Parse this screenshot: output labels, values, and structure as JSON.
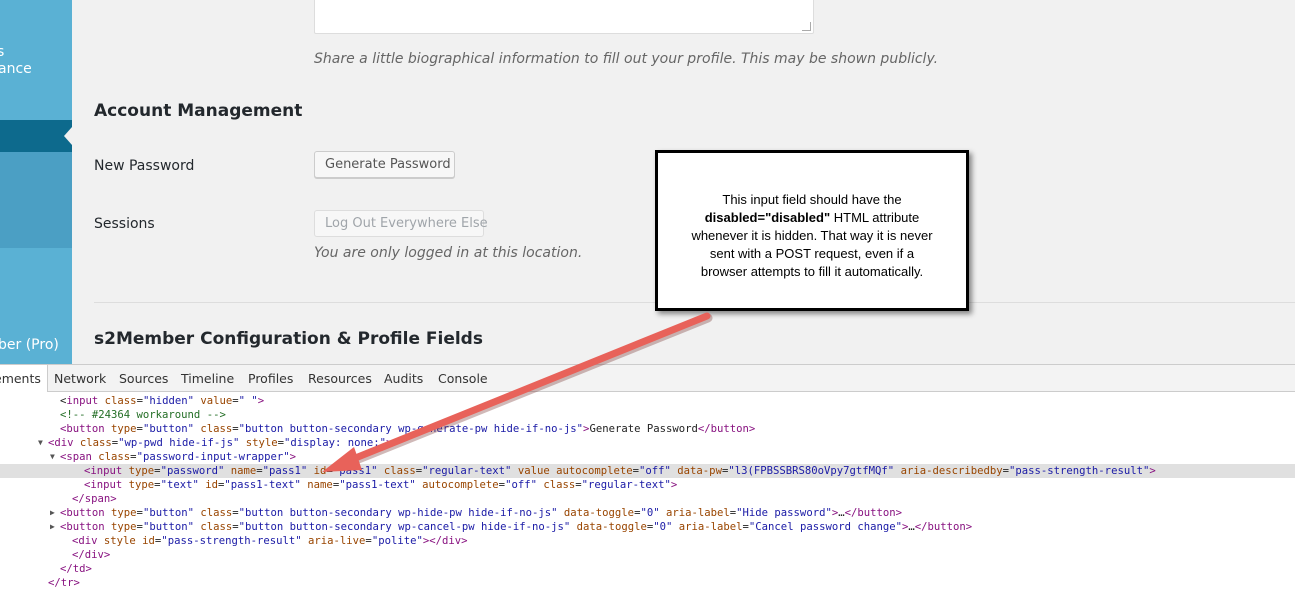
{
  "sidebar": {
    "items": [
      {
        "label": "s"
      },
      {
        "label": "ance"
      },
      {
        "label": "ber (Pro)"
      }
    ]
  },
  "profile": {
    "bio_description": "Share a little biographical information to fill out your profile. This may be shown publicly.",
    "account_heading": "Account Management",
    "new_password_label": "New Password",
    "generate_password_button": "Generate Password",
    "sessions_label": "Sessions",
    "logout_everywhere_button": "Log Out Everywhere Else",
    "sessions_description": "You are only logged in at this location.",
    "s2member_heading": "s2Member Configuration & Profile Fields"
  },
  "callout": {
    "line1": "This input field should have the",
    "bold": "disabled=\"disabled\"",
    "line2_rest": " HTML attribute",
    "line3": "whenever it is hidden. That way it is never",
    "line4": "sent with a POST request, even if a",
    "line5": "browser attempts to fill it automatically."
  },
  "devtools": {
    "tabs": [
      "ements",
      "Network",
      "Sources",
      "Timeline",
      "Profiles",
      "Resources",
      "Audits",
      "Console"
    ],
    "active_tab": "ements",
    "lines": [
      {
        "indent": 5,
        "tri": "",
        "sel": false,
        "parts": [
          [
            "tx",
            "<"
          ],
          [
            "tag",
            "input "
          ],
          [
            "an",
            "class"
          ],
          [
            "tx",
            "="
          ],
          [
            "av",
            "\"hidden\" "
          ],
          [
            "an",
            "value"
          ],
          [
            "tx",
            "="
          ],
          [
            "av",
            "\" \""
          ],
          [
            "tag",
            ">"
          ]
        ]
      },
      {
        "indent": 5,
        "tri": "",
        "sel": false,
        "parts": [
          [
            "cm",
            "<!-- #24364 workaround -->"
          ]
        ]
      },
      {
        "indent": 5,
        "tri": "",
        "sel": false,
        "parts": [
          [
            "tag",
            "<button "
          ],
          [
            "an",
            "type"
          ],
          [
            "tx",
            "="
          ],
          [
            "av",
            "\"button\" "
          ],
          [
            "an",
            "class"
          ],
          [
            "tx",
            "="
          ],
          [
            "av",
            "\"button button-secondary wp-generate-pw hide-if-no-js\""
          ],
          [
            "tag",
            ">"
          ],
          [
            "tx",
            "Generate Password"
          ],
          [
            "tag",
            "</button>"
          ]
        ]
      },
      {
        "indent": 4,
        "tri": "▼",
        "sel": false,
        "parts": [
          [
            "tag",
            "<div "
          ],
          [
            "an",
            "class"
          ],
          [
            "tx",
            "="
          ],
          [
            "av",
            "\"wp-pwd hide-if-js\" "
          ],
          [
            "an",
            "style"
          ],
          [
            "tx",
            "="
          ],
          [
            "av",
            "\"display: none;\""
          ],
          [
            "tag",
            ">"
          ]
        ]
      },
      {
        "indent": 5,
        "tri": "▼",
        "sel": false,
        "parts": [
          [
            "tag",
            "<span "
          ],
          [
            "an",
            "class"
          ],
          [
            "tx",
            "="
          ],
          [
            "av",
            "\"password-input-wrapper\""
          ],
          [
            "tag",
            ">"
          ]
        ]
      },
      {
        "indent": 7,
        "tri": "",
        "sel": true,
        "parts": [
          [
            "tag",
            "<input "
          ],
          [
            "an",
            "type"
          ],
          [
            "tx",
            "="
          ],
          [
            "av",
            "\"password\" "
          ],
          [
            "an",
            "name"
          ],
          [
            "tx",
            "="
          ],
          [
            "av",
            "\"pass1\" "
          ],
          [
            "an",
            "id"
          ],
          [
            "tx",
            "="
          ],
          [
            "av",
            "\"pass1\" "
          ],
          [
            "an",
            "class"
          ],
          [
            "tx",
            "="
          ],
          [
            "av",
            "\"regular-text\" "
          ],
          [
            "an",
            "value autocomplete"
          ],
          [
            "tx",
            "="
          ],
          [
            "av",
            "\"off\" "
          ],
          [
            "an",
            "data-pw"
          ],
          [
            "tx",
            "="
          ],
          [
            "av",
            "\"l3(FPBSSBRS80oVpy7gtfMQf\" "
          ],
          [
            "an",
            "aria-describedby"
          ],
          [
            "tx",
            "="
          ],
          [
            "av",
            "\"pass-strength-result\""
          ],
          [
            "tag",
            ">"
          ]
        ]
      },
      {
        "indent": 7,
        "tri": "",
        "sel": false,
        "parts": [
          [
            "tag",
            "<input "
          ],
          [
            "an",
            "type"
          ],
          [
            "tx",
            "="
          ],
          [
            "av",
            "\"text\" "
          ],
          [
            "an",
            "id"
          ],
          [
            "tx",
            "="
          ],
          [
            "av",
            "\"pass1-text\" "
          ],
          [
            "an",
            "name"
          ],
          [
            "tx",
            "="
          ],
          [
            "av",
            "\"pass1-text\" "
          ],
          [
            "an",
            "autocomplete"
          ],
          [
            "tx",
            "="
          ],
          [
            "av",
            "\"off\" "
          ],
          [
            "an",
            "class"
          ],
          [
            "tx",
            "="
          ],
          [
            "av",
            "\"regular-text\""
          ],
          [
            "tag",
            ">"
          ]
        ]
      },
      {
        "indent": 6,
        "tri": "",
        "sel": false,
        "parts": [
          [
            "tag",
            "</span>"
          ]
        ]
      },
      {
        "indent": 5,
        "tri": "▶",
        "sel": false,
        "parts": [
          [
            "tag",
            "<button "
          ],
          [
            "an",
            "type"
          ],
          [
            "tx",
            "="
          ],
          [
            "av",
            "\"button\" "
          ],
          [
            "an",
            "class"
          ],
          [
            "tx",
            "="
          ],
          [
            "av",
            "\"button button-secondary wp-hide-pw hide-if-no-js\" "
          ],
          [
            "an",
            "data-toggle"
          ],
          [
            "tx",
            "="
          ],
          [
            "av",
            "\"0\" "
          ],
          [
            "an",
            "aria-label"
          ],
          [
            "tx",
            "="
          ],
          [
            "av",
            "\"Hide password\""
          ],
          [
            "tag",
            ">"
          ],
          [
            "tx",
            "…"
          ],
          [
            "tag",
            "</button>"
          ]
        ]
      },
      {
        "indent": 5,
        "tri": "▶",
        "sel": false,
        "parts": [
          [
            "tag",
            "<button "
          ],
          [
            "an",
            "type"
          ],
          [
            "tx",
            "="
          ],
          [
            "av",
            "\"button\" "
          ],
          [
            "an",
            "class"
          ],
          [
            "tx",
            "="
          ],
          [
            "av",
            "\"button button-secondary wp-cancel-pw hide-if-no-js\" "
          ],
          [
            "an",
            "data-toggle"
          ],
          [
            "tx",
            "="
          ],
          [
            "av",
            "\"0\" "
          ],
          [
            "an",
            "aria-label"
          ],
          [
            "tx",
            "="
          ],
          [
            "av",
            "\"Cancel password change\""
          ],
          [
            "tag",
            ">"
          ],
          [
            "tx",
            "…"
          ],
          [
            "tag",
            "</button>"
          ]
        ]
      },
      {
        "indent": 6,
        "tri": "",
        "sel": false,
        "parts": [
          [
            "tag",
            "<div "
          ],
          [
            "an",
            "style id"
          ],
          [
            "tx",
            "="
          ],
          [
            "av",
            "\"pass-strength-result\" "
          ],
          [
            "an",
            "aria-live"
          ],
          [
            "tx",
            "="
          ],
          [
            "av",
            "\"polite\""
          ],
          [
            "tag",
            "></div>"
          ]
        ]
      },
      {
        "indent": 6,
        "tri": "",
        "sel": false,
        "parts": [
          [
            "tag",
            "</div>"
          ]
        ]
      },
      {
        "indent": 5,
        "tri": "",
        "sel": false,
        "parts": [
          [
            "tag",
            "</td>"
          ]
        ]
      },
      {
        "indent": 4,
        "tri": "",
        "sel": false,
        "parts": [
          [
            "tag",
            "</tr>"
          ]
        ]
      }
    ]
  },
  "colors": {
    "sidebar": "#5ab1d4",
    "sidebar_active": "#0d6a8d",
    "arrow": "#e8625a",
    "tag": "#881280",
    "attr_name": "#994500",
    "attr_value": "#1a1aa6"
  }
}
